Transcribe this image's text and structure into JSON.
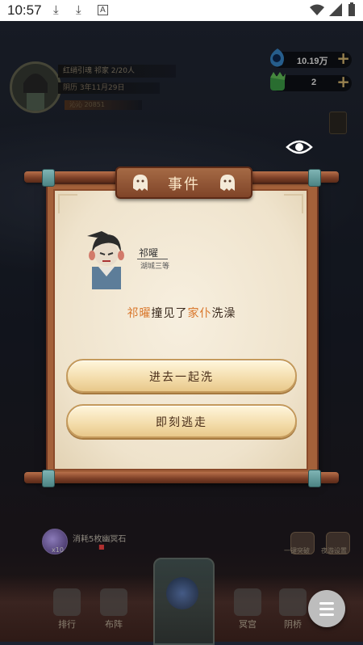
{
  "status_bar": {
    "time": "10:57",
    "icons": [
      "download-icon",
      "download-icon",
      "notification-a-icon",
      "wifi-icon",
      "signal-icon",
      "battery-icon"
    ]
  },
  "profile": {
    "line1": "红绡引魂   祁家 2/20人",
    "line2": "阴历 3年11月29日",
    "line3": "沁沁 20851"
  },
  "currencies": [
    {
      "name": "soul-jade",
      "value": "10.19万"
    },
    {
      "name": "green-spirit",
      "value": "2"
    }
  ],
  "dialog": {
    "title": "事件",
    "npc": {
      "name": "祁曜",
      "subtitle": "湖城三等"
    },
    "event": {
      "actor": "祁曜",
      "verb": "撞见了",
      "target": "家仆",
      "action": "洗澡"
    },
    "choices": [
      {
        "label": "进去一起洗"
      },
      {
        "label": "即刻逃走"
      }
    ]
  },
  "bottom": {
    "consume_text": "消耗5枚幽冥石",
    "consume_count": "x10",
    "right_buttons": [
      {
        "label": "一键突破"
      },
      {
        "label": "夜游设置"
      }
    ]
  },
  "nav": {
    "items": [
      {
        "label": "排行"
      },
      {
        "label": "布阵"
      },
      {
        "label": "冥宫"
      },
      {
        "label": "阴桥"
      }
    ]
  },
  "colors": {
    "highlight": "#d9762a",
    "frame": "#a4613a",
    "paper": "#f3e8d2"
  }
}
